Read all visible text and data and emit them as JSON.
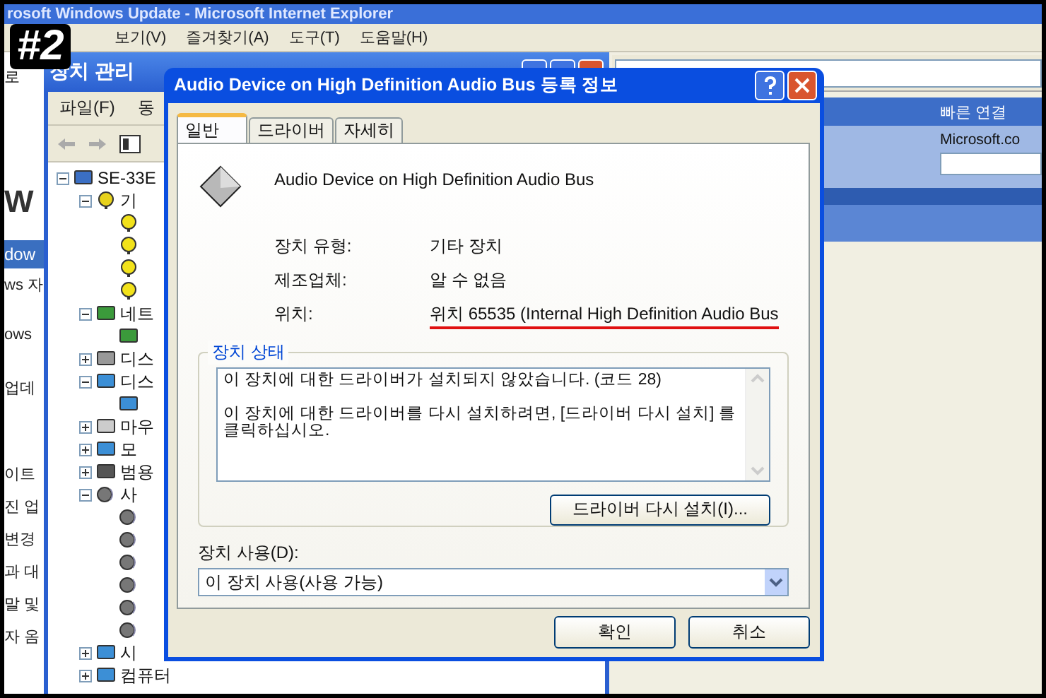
{
  "annotation": {
    "label": "#2"
  },
  "browser": {
    "title": "rosoft Windows Update - Microsoft Internet Explorer",
    "menu": [
      "보기(V)",
      "즐겨찾기(A)",
      "도구(T)",
      "도움말(H)"
    ],
    "side_texts": [
      {
        "kind": "text",
        "text": "로"
      },
      {
        "kind": "heading",
        "text": "W"
      },
      {
        "kind": "band",
        "text": "dow"
      },
      {
        "kind": "text",
        "text": "ws 자"
      },
      {
        "kind": "text",
        "text": "ows"
      },
      {
        "kind": "text",
        "text": "업데"
      },
      {
        "kind": "text",
        "text": "이트"
      },
      {
        "kind": "text",
        "text": "진 업"
      },
      {
        "kind": "text",
        "text": "변경"
      },
      {
        "kind": "text",
        "text": "과 대"
      },
      {
        "kind": "text",
        "text": "말 및"
      },
      {
        "kind": "text",
        "text": "자 옴"
      }
    ],
    "quick_links": "빠른 연결",
    "search_label": "Microsoft.co"
  },
  "device_manager": {
    "title": "장치 관리",
    "menu": [
      "파일(F)",
      "동"
    ],
    "tree": [
      {
        "label": "SE-33E",
        "kind": "computer",
        "expanded": true,
        "children": [
          {
            "label": "기",
            "kind": "unknown",
            "expanded": true,
            "children": [
              {
                "kind": "question"
              },
              {
                "kind": "question"
              },
              {
                "kind": "question"
              },
              {
                "kind": "question"
              }
            ]
          },
          {
            "label": "네트",
            "kind": "network",
            "expanded": true,
            "children": [
              {
                "kind": "network"
              }
            ]
          },
          {
            "label": "디스",
            "kind": "drive",
            "expanded": false
          },
          {
            "label": "디스",
            "kind": "display",
            "expanded": true,
            "children": [
              {
                "kind": "display"
              }
            ]
          },
          {
            "label": "마우",
            "kind": "mouse",
            "expanded": false
          },
          {
            "label": "모",
            "kind": "display",
            "expanded": false
          },
          {
            "label": "범용",
            "kind": "usb",
            "expanded": false
          },
          {
            "label": "사",
            "kind": "sound",
            "expanded": true,
            "children": [
              {
                "kind": "sound"
              },
              {
                "kind": "sound"
              },
              {
                "kind": "sound"
              },
              {
                "kind": "sound"
              },
              {
                "kind": "sound"
              },
              {
                "kind": "sound"
              }
            ]
          },
          {
            "label": "시",
            "kind": "display",
            "expanded": false
          },
          {
            "label": "컴퓨터",
            "kind": "display",
            "expanded": false
          }
        ]
      }
    ]
  },
  "dialog": {
    "title": "Audio Device on High Definition Audio Bus 등록 정보",
    "tabs": [
      {
        "label": "일반",
        "selected": true
      },
      {
        "label": "드라이버",
        "selected": false
      },
      {
        "label": "자세히",
        "selected": false
      }
    ],
    "device_name": "Audio Device on High Definition Audio Bus",
    "properties": [
      {
        "label": "장치 유형:",
        "value": "기타 장치",
        "highlighted": false
      },
      {
        "label": "제조업체:",
        "value": "알 수 없음",
        "highlighted": false
      },
      {
        "label": "위치:",
        "value": "위치 65535 (Internal High Definition Audio Bus",
        "highlighted": true
      }
    ],
    "status": {
      "title": "장치 상태",
      "paragraphs": [
        "이 장치에 대한 드라이버가 설치되지 않았습니다. (코드 28)",
        "이 장치에 대한 드라이버를 다시 설치하려면, [드라이버 다시 설치] 를 클릭하십시오."
      ],
      "button": "드라이버 다시 설치(I)..."
    },
    "usage": {
      "label": "장치 사용(D):",
      "value": "이 장치 사용(사용 가능)"
    },
    "buttons": [
      {
        "label": "확인"
      },
      {
        "label": "취소"
      }
    ]
  }
}
